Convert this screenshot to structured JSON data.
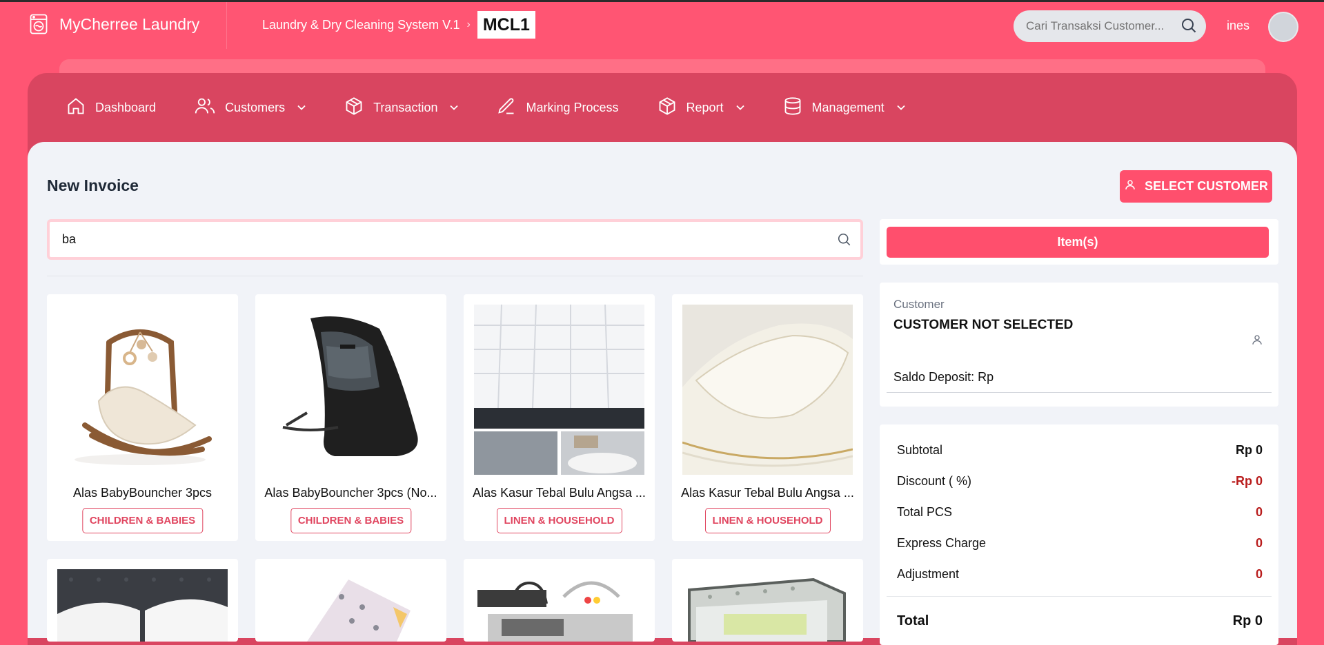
{
  "app": {
    "brand": "MyCherree Laundry",
    "system_name": "Laundry & Dry Cleaning System V.1",
    "outlet_code": "MCL1"
  },
  "header": {
    "search_placeholder": "Cari Transaksi Customer...",
    "user_name": "ines"
  },
  "nav": {
    "dashboard": "Dashboard",
    "customers": "Customers",
    "transaction": "Transaction",
    "marking": "Marking Process",
    "report": "Report",
    "management": "Management"
  },
  "page": {
    "title": "New Invoice",
    "select_customer": "SELECT CUSTOMER",
    "search_value": "ba"
  },
  "products": [
    {
      "name": "Alas BabyBouncher 3pcs",
      "category": "CHILDREN & BABIES"
    },
    {
      "name": "Alas BabyBouncher 3pcs (No...",
      "category": "CHILDREN & BABIES"
    },
    {
      "name": "Alas Kasur Tebal Bulu Angsa ...",
      "category": "LINEN & HOUSEHOLD"
    },
    {
      "name": "Alas Kasur Tebal Bulu Angsa ...",
      "category": "LINEN & HOUSEHOLD"
    }
  ],
  "sidebar": {
    "items_button": "Item(s)",
    "customer_label": "Customer",
    "customer_name": "CUSTOMER NOT SELECTED",
    "saldo": "Saldo Deposit: Rp"
  },
  "summary": {
    "subtotal_label": "Subtotal",
    "subtotal_value": "Rp 0",
    "discount_label": "Discount ( %)",
    "discount_value": "-Rp 0",
    "pcs_label": "Total PCS",
    "pcs_value": "0",
    "express_label": "Express Charge",
    "express_value": "0",
    "adjustment_label": "Adjustment",
    "adjustment_value": "0",
    "total_label": "Total",
    "total_value": "Rp 0"
  },
  "colors": {
    "primary": "#ff4f6d",
    "nav_bg": "#d94560",
    "content_bg": "#f1f3f8"
  }
}
